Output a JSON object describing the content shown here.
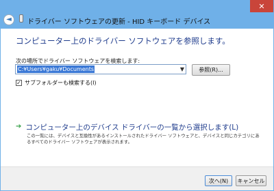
{
  "window": {
    "title": "ドライバー ソフトウェアの更新 - HID キーボード デバイス",
    "back_glyph": "◄",
    "close_glyph": "✕",
    "accent": "#6fb0e8",
    "close_color": "#c9453a"
  },
  "main": {
    "heading": "コンピューター上のドライバー ソフトウェアを参照します。",
    "search_label": "次の場所でドライバー ソフトウェアを検索します:",
    "path_value": "C:¥Users¥gaku¥Documents",
    "browse_label": "参照(R)...",
    "include_subfolders_label": "サブフォルダーも検索する(I)",
    "include_subfolders_checked": true,
    "pick_from_list_label": "コンピューター上のデバイス ドライバーの一覧から選択します(L)",
    "pick_from_list_desc": "この一覧には、デバイスと互換性があるインストールされたドライバー ソフトウェアと、デバイスと同じカテゴリにあるすべてのドライバー ソフトウェアが表示されます。",
    "link_color": "#1e3b8c"
  },
  "footer": {
    "next_label": "次へ(N)",
    "cancel_label": "キャンセル"
  }
}
